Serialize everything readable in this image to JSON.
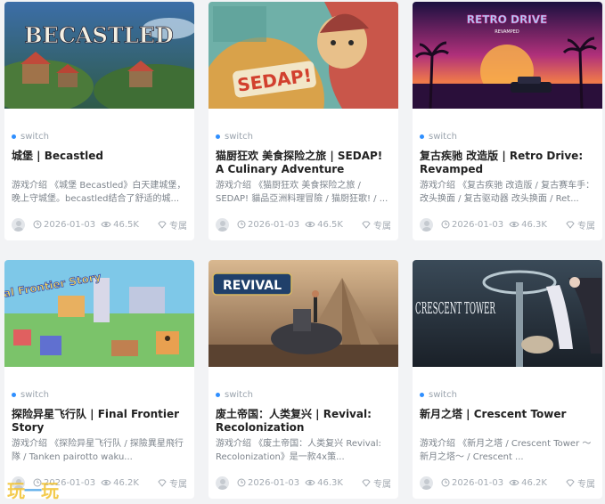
{
  "colors": {
    "accent_dot": "#2f8fff",
    "card_bg": "#ffffff",
    "page_bg": "#f2f3f5"
  },
  "icons": {
    "date": "clock-icon",
    "views": "eye-icon",
    "exclusive": "diamond-icon"
  },
  "cards": [
    {
      "category": "switch",
      "cover_text": "BECASTLED",
      "title": "城堡 | Becastled",
      "desc": "游戏介绍 《城堡 Becastled》白天建城堡，晚上守城堡。becastled结合了舒适的城...",
      "date": "2026-01-03",
      "views": "46.5K",
      "badge": "专属"
    },
    {
      "category": "switch",
      "cover_text": "SEDAP!",
      "title": "猫厨狂欢 美食探险之旅 | SEDAP! A Culinary Adventure",
      "desc": "游戏介绍 《猫厨狂欢 美食探险之旅 / SEDAP! 貓品亞洲料理冒險 / 猫厨狂歌! / ...",
      "date": "2026-01-03",
      "views": "46.5K",
      "badge": "专属"
    },
    {
      "category": "switch",
      "cover_text": "RETRO DRIVE",
      "cover_subtext": "REVAMPED",
      "title": "复古疾驰 改造版 | Retro Drive: Revamped",
      "desc": "游戏介绍 《复古疾驰 改造版 / 复古赛车手：改头换面 / 复古驱动器 改头换面 / Ret...",
      "date": "2026-01-03",
      "views": "46.3K",
      "badge": "专属"
    },
    {
      "category": "switch",
      "cover_text": "Final Frontier Story",
      "title": "探险异星飞行队 | Final Frontier Story",
      "desc": "游戏介绍 《探险异星飞行队 / 探險異星飛行隊 / Tanken pairotto waku...",
      "date": "2026-01-03",
      "views": "46.2K",
      "badge": "专属"
    },
    {
      "category": "switch",
      "cover_text": "REVIVAL",
      "title": "废土帝国：人类复兴 | Revival: Recolonization",
      "desc": "游戏介绍 《废土帝国：人类复兴 Revival: Recolonization》是一款4x策...",
      "date": "2026-01-03",
      "views": "46.3K",
      "badge": "专属"
    },
    {
      "category": "switch",
      "cover_text": "CRESCENT TOWER",
      "title": "新月之塔 | Crescent Tower",
      "desc": "游戏介绍 《新月之塔 / Crescent Tower ～新月之塔～ / Crescent ...",
      "date": "2026-01-03",
      "views": "46.2K",
      "badge": "专属"
    }
  ],
  "watermark": {
    "part1": "玩",
    "part2": "一",
    "part3": "玩"
  }
}
